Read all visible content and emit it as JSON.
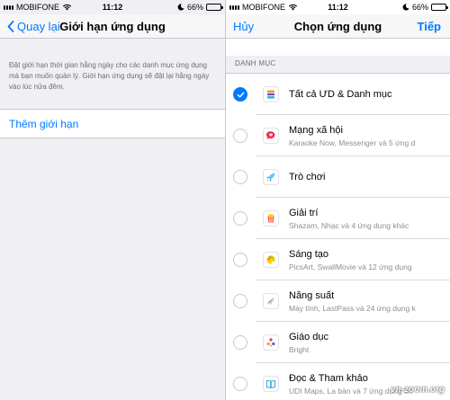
{
  "left": {
    "status": {
      "carrier": "MOBIFONE",
      "time": "11:12",
      "battery": "66%",
      "battery_level": 0.66
    },
    "nav": {
      "back_label": "Quay lại",
      "title": "Giới hạn ứng dụng"
    },
    "description": "Đặt giới hạn thời gian hằng ngày cho các danh mục ứng dụng mà bạn muốn quản lý. Giới hạn ứng dụng sẽ đặt lại hằng ngày vào lúc nửa đêm.",
    "add_limit_label": "Thêm giới hạn"
  },
  "right": {
    "status": {
      "carrier": "MOBIFONE",
      "time": "11:12",
      "battery": "66%",
      "battery_level": 0.66
    },
    "nav": {
      "cancel_label": "Hủy",
      "title": "Chọn ứng dụng",
      "next_label": "Tiếp"
    },
    "section_header": "DANH MỤC",
    "categories": [
      {
        "title": "Tất cả ƯD & Danh mục",
        "subtitle": "",
        "checked": true,
        "icon": "stack-icon"
      },
      {
        "title": "Mạng xã hội",
        "subtitle": "Karaoke Now, Messenger và 5 ứng d",
        "checked": false,
        "icon": "chat-bubble-icon"
      },
      {
        "title": "Trò chơi",
        "subtitle": "",
        "checked": false,
        "icon": "rocket-icon"
      },
      {
        "title": "Giải trí",
        "subtitle": "Shazam, Nhạc và 4 ứng dụng khác",
        "checked": false,
        "icon": "popcorn-icon"
      },
      {
        "title": "Sáng tạo",
        "subtitle": "PicsArt, SwallMovie và 12 ứng dụng",
        "checked": false,
        "icon": "palette-icon"
      },
      {
        "title": "Năng suất",
        "subtitle": "Máy tính, LastPass và 24 ứng dụng k",
        "checked": false,
        "icon": "paper-plane-icon"
      },
      {
        "title": "Giáo dục",
        "subtitle": "Bright",
        "checked": false,
        "icon": "education-icon"
      },
      {
        "title": "Đọc & Tham khảo",
        "subtitle": "UDI Maps, La bàn và 7 ứng dụng kh",
        "checked": false,
        "icon": "book-icon"
      }
    ],
    "watermark": "vn-zoom.org"
  },
  "colors": {
    "accent": "#007aff",
    "background_grouped": "#efeff4",
    "secondary_text": "#8e8e93"
  }
}
